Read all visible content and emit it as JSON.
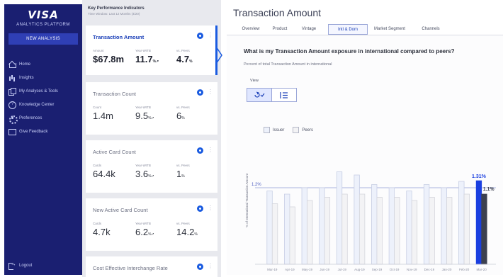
{
  "sidebar": {
    "logo": "VISA",
    "subtitle": "ANALYTICS PLATFORM",
    "new_analysis_label": "NEW ANALYSIS",
    "items": [
      {
        "label": "Home",
        "icon": "home-icon"
      },
      {
        "label": "Insights",
        "icon": "bar-chart-icon"
      },
      {
        "label": "My Analyses & Tools",
        "icon": "copy-icon"
      },
      {
        "label": "Knowledge Center",
        "icon": "question-icon"
      },
      {
        "label": "Preferences",
        "icon": "gear-icon"
      },
      {
        "label": "Give Feedback",
        "icon": "feedback-icon"
      }
    ],
    "logout_label": "Logout"
  },
  "kpi_panel": {
    "title": "Key Performance Indicators",
    "subtitle": "Time Window: Last 12 Months (4/20)",
    "cards": [
      {
        "name": "Transaction Amount",
        "active": true,
        "metrics": [
          {
            "label": "Amount",
            "value": "$67.8m",
            "suffix": ""
          },
          {
            "label": "Year-WITB",
            "value": "11.7",
            "suffix": "%↗"
          },
          {
            "label": "vs. Peers",
            "value": "4.7",
            "suffix": "%"
          }
        ]
      },
      {
        "name": "Transaction Count",
        "active": false,
        "metrics": [
          {
            "label": "Count",
            "value": "1.4m",
            "suffix": ""
          },
          {
            "label": "Year-WITB",
            "value": "9.5",
            "suffix": "%↗"
          },
          {
            "label": "vs. Peers",
            "value": "6",
            "suffix": "%"
          }
        ]
      },
      {
        "name": "Active Card Count",
        "active": false,
        "metrics": [
          {
            "label": "Cards",
            "value": "64.4k",
            "suffix": ""
          },
          {
            "label": "Year-WITB",
            "value": "3.6",
            "suffix": "%↗"
          },
          {
            "label": "vs. Peers",
            "value": "1",
            "suffix": "%"
          }
        ]
      },
      {
        "name": "New Active Card Count",
        "active": false,
        "metrics": [
          {
            "label": "Cards",
            "value": "4.7k",
            "suffix": ""
          },
          {
            "label": "Year-WITB",
            "value": "6.2",
            "suffix": "%↗"
          },
          {
            "label": "vs. Peers",
            "value": "14.2",
            "suffix": "%"
          }
        ]
      },
      {
        "name": "Cost Effective Interchange Rate",
        "active": false,
        "metrics": []
      }
    ]
  },
  "main": {
    "title": "Transaction Amount",
    "tabs": [
      {
        "label": "Overview",
        "active": false
      },
      {
        "label": "Product",
        "active": false
      },
      {
        "label": "Vintage",
        "active": false
      },
      {
        "label": "Intl & Dom",
        "active": true
      },
      {
        "label": "Market Segment",
        "active": false
      },
      {
        "label": "Channels",
        "active": false
      }
    ],
    "question": "What is my Transaction Amount exposure in international compared to peers?",
    "subtitle": "Percent of total Transaction Amount in international",
    "view_label": "View",
    "view_options": [
      "chart-view-icon",
      "list-view-icon"
    ]
  },
  "chart_data": {
    "type": "bar",
    "legend": [
      "Issuer",
      "Peers"
    ],
    "legend_placement": "top-left",
    "ylabel": "% of International Transaction Amount",
    "categories": [
      "Mar-19",
      "Apr-19",
      "May-19",
      "Jun-19",
      "Jul-19",
      "Aug-19",
      "Sep-19",
      "Oct-19",
      "Nov-19",
      "Dec-19",
      "Jan-20",
      "Feb-20",
      "Mar-20"
    ],
    "series": [
      {
        "name": "Issuer",
        "values": [
          1.15,
          1.1,
          1.2,
          1.2,
          1.45,
          1.4,
          1.25,
          1.2,
          1.15,
          1.25,
          1.2,
          1.3,
          1.31
        ]
      },
      {
        "name": "Peers",
        "values": [
          0.95,
          0.9,
          1.0,
          1.05,
          1.1,
          1.1,
          1.05,
          1.05,
          1.0,
          1.05,
          1.05,
          1.1,
          1.1
        ]
      }
    ],
    "reference_line": {
      "value": 1.2,
      "label": "1.2%"
    },
    "highlight_labels": {
      "issuer": "1.31%",
      "peers": "1.1%"
    },
    "ylim": [
      0,
      1.6
    ],
    "grid": false,
    "colors": {
      "issuer": "#edf1fb",
      "peers": "#f3f3f5",
      "issuer_highlight": "#1a3fe0",
      "peers_highlight": "#3c4050"
    }
  }
}
